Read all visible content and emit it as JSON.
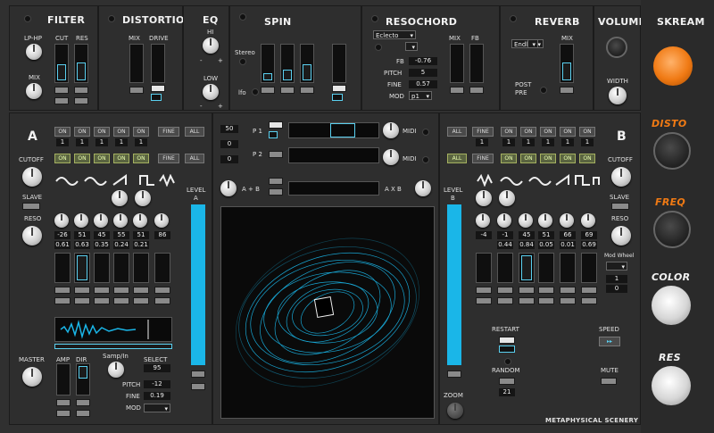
{
  "app": {
    "brand": "METAPHYSICAL SCENERY",
    "accent_color": "#1ab6e8",
    "orange_color": "#f07a14"
  },
  "filter": {
    "title": "FILTER",
    "lphp": "LP-HP",
    "cut": "CUT",
    "res": "RES",
    "mix": "MIX"
  },
  "distortion": {
    "title": "DISTORTION",
    "mix": "MIX",
    "drive": "DRIVE"
  },
  "eq": {
    "title": "EQ",
    "hi": "HI",
    "low": "LOW",
    "minus": "-",
    "plus": "+"
  },
  "spin": {
    "title": "SPIN",
    "stereo": "Stereo",
    "lfo": "lfo"
  },
  "resochord": {
    "title": "RESOCHORD",
    "preset": "Eclecto",
    "fb_label": "FB",
    "fb_value": "-0.76",
    "pitch_label": "PITCH",
    "pitch_value": "5",
    "fine_label": "FINE",
    "fine_value": "0.57",
    "mod_label": "MOD",
    "mod_value": "p1",
    "mix": "MIX",
    "fb": "FB"
  },
  "reverb": {
    "title": "REVERB",
    "mode": "Endless",
    "mix": "MIX",
    "post": "POST",
    "pre": "PRE"
  },
  "volume": {
    "title": "VOLUME",
    "width": "WIDTH"
  },
  "skream": {
    "title": "SKREAM",
    "disto": "DISTO",
    "freq": "FREQ",
    "color": "COLOR",
    "res": "RES"
  },
  "layer_a": {
    "letter": "A",
    "cutoff": "CUTOFF",
    "slave": "SLAVE",
    "reso": "RESO",
    "toggles_row1": [
      "ON",
      "ON",
      "ON",
      "ON",
      "ON",
      "FINE",
      "ALL"
    ],
    "values_row1": [
      "1",
      "1",
      "1",
      "1",
      "1"
    ],
    "toggles_row2": [
      "ON",
      "ON",
      "ON",
      "ON",
      "ON",
      "FINE",
      "ALL"
    ],
    "knob_values": [
      "-26",
      "51",
      "45",
      "55",
      "51",
      "86"
    ],
    "fader_values": [
      "0.61",
      "0.63",
      "0.35",
      "0.24",
      "0.21"
    ],
    "level_label": "LEVEL",
    "level_letter": "A",
    "master": "MASTER",
    "amp": "AMP",
    "dir": "DIR",
    "samp_in": "Samp/In",
    "select": "SELECT",
    "select_value": "95",
    "pitch": "PITCH",
    "pitch_value": "-12",
    "fine": "FINE",
    "fine_value": "0.19",
    "mod": "MOD"
  },
  "layer_b": {
    "letter": "B",
    "cutoff": "CUTOFF",
    "slave": "SLAVE",
    "reso": "RESO",
    "toggles_row1": [
      "ALL",
      "FINE",
      "ON",
      "ON",
      "ON",
      "ON",
      "ON"
    ],
    "values_row1": [
      "1",
      "1",
      "1",
      "1",
      "1",
      "1"
    ],
    "toggles_row2": [
      "ALL",
      "FINE",
      "ON",
      "ON",
      "ON",
      "ON",
      "ON"
    ],
    "knob_values": [
      "-4",
      "-1",
      "45",
      "51",
      "66",
      "69"
    ],
    "fader_values": [
      "0.44",
      "0.84",
      "0.05",
      "0.01",
      "0.69"
    ],
    "level_label": "LEVEL",
    "level_letter": "B",
    "mod_wheel": "Mod Wheel",
    "mod_val1": "1",
    "mod_val2": "0",
    "restart": "RESTART",
    "random": "RANDOM",
    "random_value": "21",
    "speed": "SPEED",
    "mute": "MUTE",
    "zoom": "ZOOM"
  },
  "center": {
    "p1": "P 1",
    "p2": "P 2",
    "val50": "50",
    "val0a": "0",
    "val0b": "0",
    "midi1": "MIDI",
    "midi2": "MIDI",
    "a_plus_b": "A + B",
    "a_x_b": "A X B"
  }
}
